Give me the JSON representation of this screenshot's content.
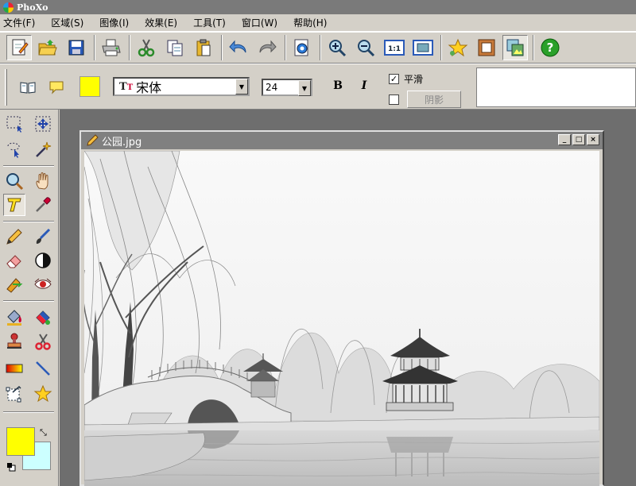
{
  "app": {
    "title": "PhoXo"
  },
  "menu": [
    {
      "label": "文件(F)"
    },
    {
      "label": "区域(S)"
    },
    {
      "label": "图像(I)"
    },
    {
      "label": "效果(E)"
    },
    {
      "label": "工具(T)"
    },
    {
      "label": "窗口(W)"
    },
    {
      "label": "帮助(H)"
    }
  ],
  "text_options": {
    "color": "#ffff00",
    "font": "宋体",
    "size": "24",
    "bold_label": "B",
    "italic_label": "I",
    "smooth_label": "平滑",
    "smooth_checked": "✓",
    "shadow_label": "阴影"
  },
  "colors": {
    "foreground": "#ffff00",
    "background": "#ccffff"
  },
  "document": {
    "title": "公园.jpg",
    "minimize": "_",
    "maximize": "□",
    "close": "×"
  }
}
